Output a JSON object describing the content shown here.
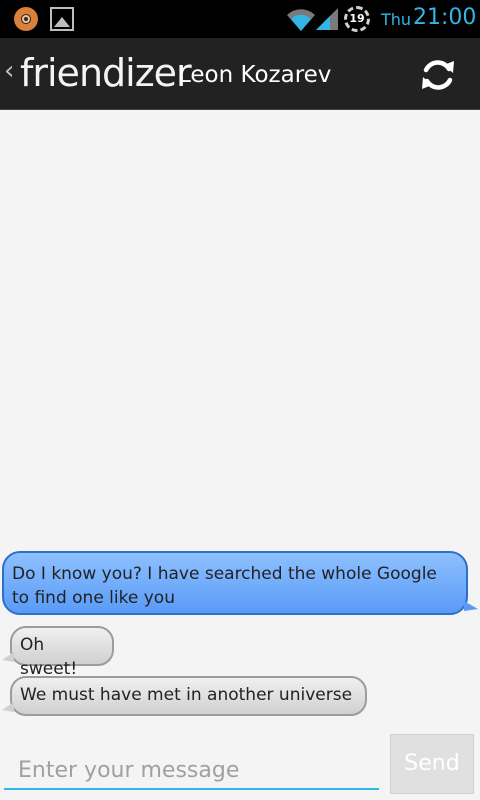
{
  "status_bar": {
    "icons": [
      "app-notification-icon",
      "image-notification-icon",
      "wifi-icon",
      "signal-icon",
      "alarm-badge-icon"
    ],
    "alarm_badge": "19",
    "day": "Thu",
    "time": "21:00",
    "accent_color": "#33b5e5"
  },
  "action_bar": {
    "logo_text": "friendizer",
    "contact_name": "Leon Kozarev",
    "back_icon": "chevron-left-icon",
    "refresh_icon": "refresh-icon"
  },
  "messages": [
    {
      "direction": "outgoing",
      "text": "Do I know you? I have searched the whole Google to find one like you"
    },
    {
      "direction": "incoming",
      "text": "Oh sweet!"
    },
    {
      "direction": "incoming",
      "text": "We must have met in another universe"
    }
  ],
  "composer": {
    "placeholder": "Enter your message",
    "value": "",
    "send_label": "Send"
  },
  "colors": {
    "outgoing_bubble": "#6aa9fa",
    "incoming_bubble": "#e2e2e2",
    "action_bar": "#222222",
    "background": "#f4f4f4"
  }
}
